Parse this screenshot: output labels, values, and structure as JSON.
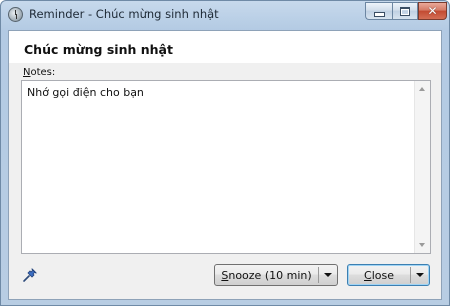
{
  "window": {
    "title": "Reminder - Chúc mừng sinh nhật",
    "icon": "alarm-clock-icon",
    "controls": {
      "minimize": "minimize-icon",
      "maximize": "maximize-icon",
      "close_glyph": "✕"
    }
  },
  "reminder": {
    "subject": "Chúc mừng sinh nhật",
    "notes_label_accel": "N",
    "notes_label_rest": "otes:",
    "notes_text": "Nhớ gọi điện cho bạn"
  },
  "footer": {
    "pin_icon": "pushpin-icon",
    "snooze_accel": "S",
    "snooze_rest": "nooze (10 min)",
    "close_accel": "C",
    "close_rest": "lose"
  },
  "colors": {
    "titlebar": "#b9cfe6",
    "close_button": "#c24a31",
    "client_bg": "#f0f0f0",
    "default_button_border": "#3c7fb1"
  }
}
